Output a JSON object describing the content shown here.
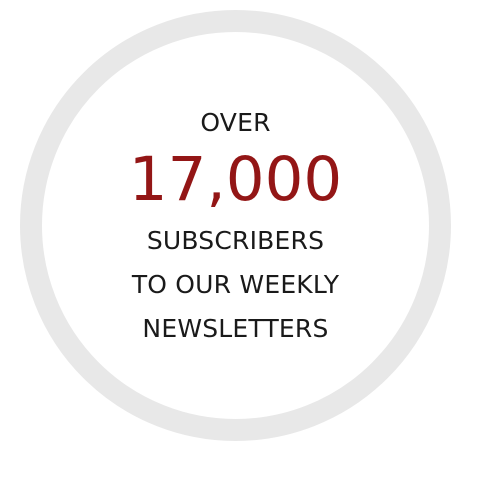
{
  "stat": {
    "prefix": "OVER",
    "number": "17,000",
    "line1": "SUBSCRIBERS",
    "line2": "TO OUR WEEKLY",
    "line3": "NEWSLETTERS"
  },
  "colors": {
    "accent": "#931616",
    "ring": "#e8e8e8",
    "text": "#1a1a1a"
  }
}
